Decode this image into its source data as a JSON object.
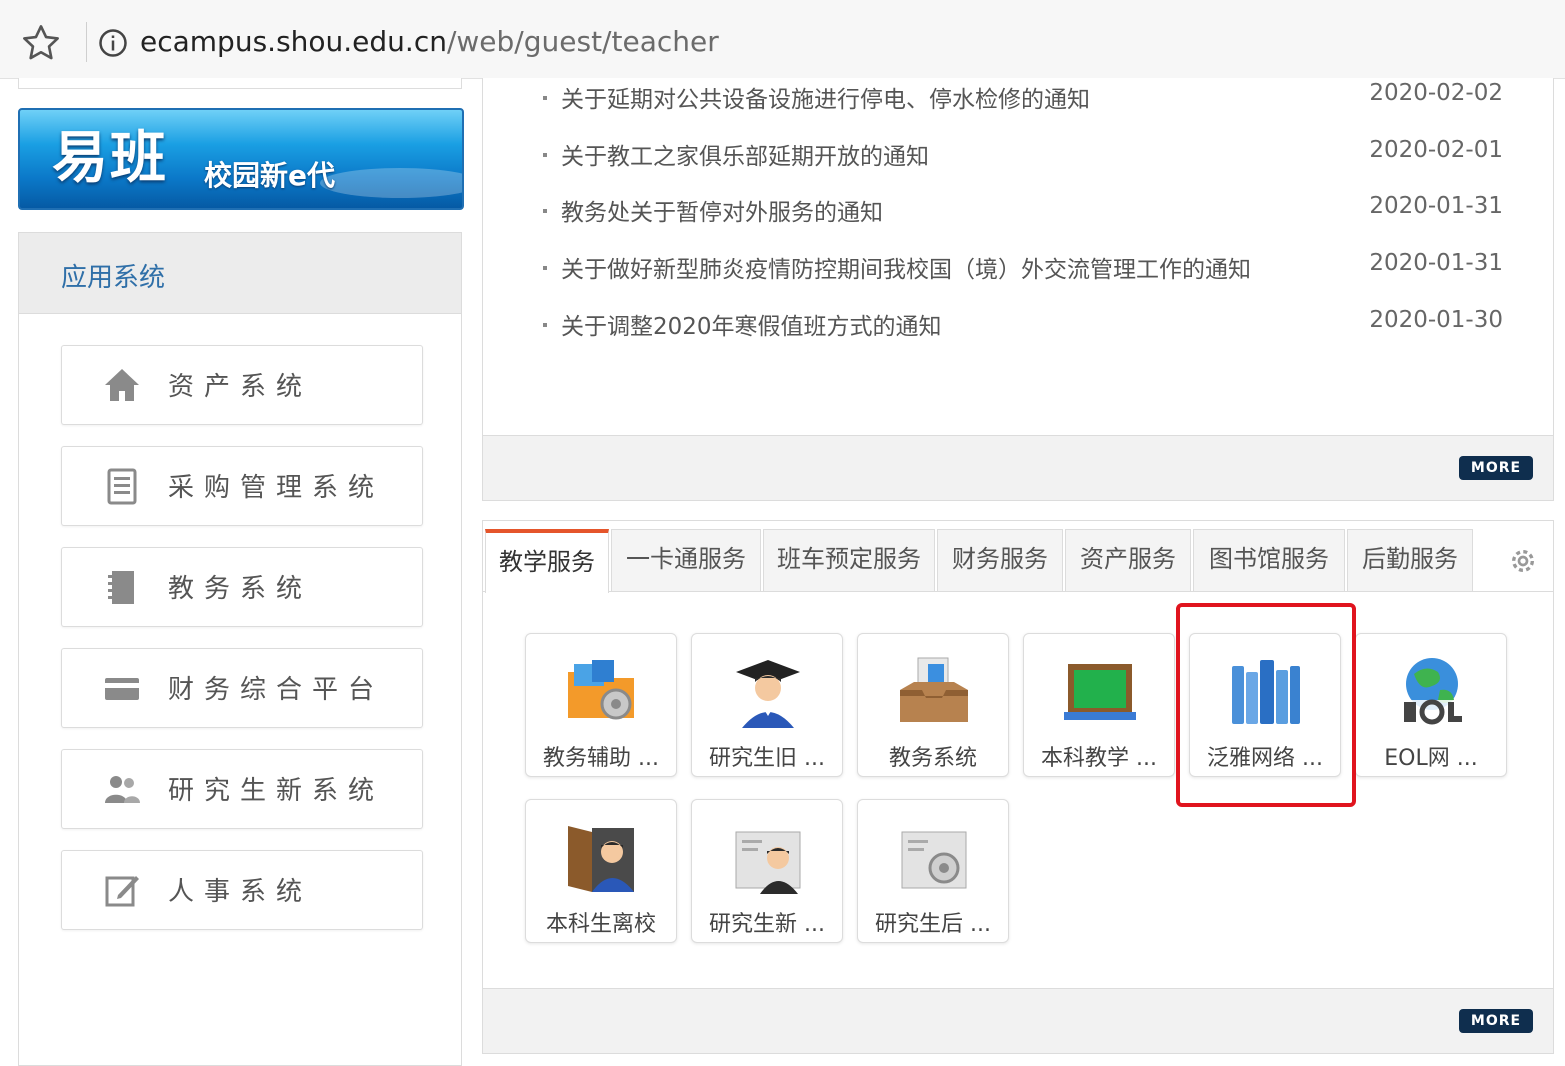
{
  "browser": {
    "url_host": "ecampus.shou.edu.cn",
    "url_path": "/web/guest/teacher"
  },
  "banner": {
    "logo_text": "易班",
    "slogan": "校园新e代"
  },
  "apps": {
    "title": "应用系统",
    "items": [
      {
        "label": "资产系统",
        "icon": "home-icon"
      },
      {
        "label": "采购管理系统",
        "icon": "document-list-icon"
      },
      {
        "label": "教务系统",
        "icon": "notebook-icon"
      },
      {
        "label": "财务综合平台",
        "icon": "card-icon"
      },
      {
        "label": "研究生新系统",
        "icon": "users-icon"
      },
      {
        "label": "人事系统",
        "icon": "edit-icon"
      }
    ]
  },
  "notices": {
    "items": [
      {
        "title": "关于延期对公共设备设施进行停电、停水检修的通知",
        "date": "2020-02-02"
      },
      {
        "title": "关于教工之家俱乐部延期开放的通知",
        "date": "2020-02-01"
      },
      {
        "title": "教务处关于暂停对外服务的通知",
        "date": "2020-01-31"
      },
      {
        "title": "关于做好新型肺炎疫情防控期间我校国（境）外交流管理工作的通知",
        "date": "2020-01-31"
      },
      {
        "title": "关于调整2020年寒假值班方式的通知",
        "date": "2020-01-30"
      }
    ],
    "more_label": "MORE"
  },
  "services": {
    "tabs": [
      "教学服务",
      "一卡通服务",
      "班车预定服务",
      "财务服务",
      "资产服务",
      "图书馆服务",
      "后勤服务"
    ],
    "active_tab": "教学服务",
    "tiles": [
      {
        "label": "教务辅助 ...",
        "icon": "folder-gear-icon"
      },
      {
        "label": "研究生旧 ...",
        "icon": "graduate-icon"
      },
      {
        "label": "教务系统",
        "icon": "inbox-icon"
      },
      {
        "label": "本科教学 ...",
        "icon": "blackboard-icon"
      },
      {
        "label": "泛雅网络 ...",
        "icon": "books-icon"
      },
      {
        "label": "EOL网 ...",
        "icon": "eol-globe-icon"
      },
      {
        "label": "本科生离校",
        "icon": "door-person-icon"
      },
      {
        "label": "研究生新 ...",
        "icon": "person-folder-icon"
      },
      {
        "label": "研究生后 ...",
        "icon": "folder-gear-grey-icon"
      }
    ],
    "more_label": "MORE"
  },
  "colors": {
    "accent_tab": "#e5552b",
    "highlight": "#e0141e",
    "link_title": "#2f6fa8",
    "more_button": "#0f2e4e"
  }
}
